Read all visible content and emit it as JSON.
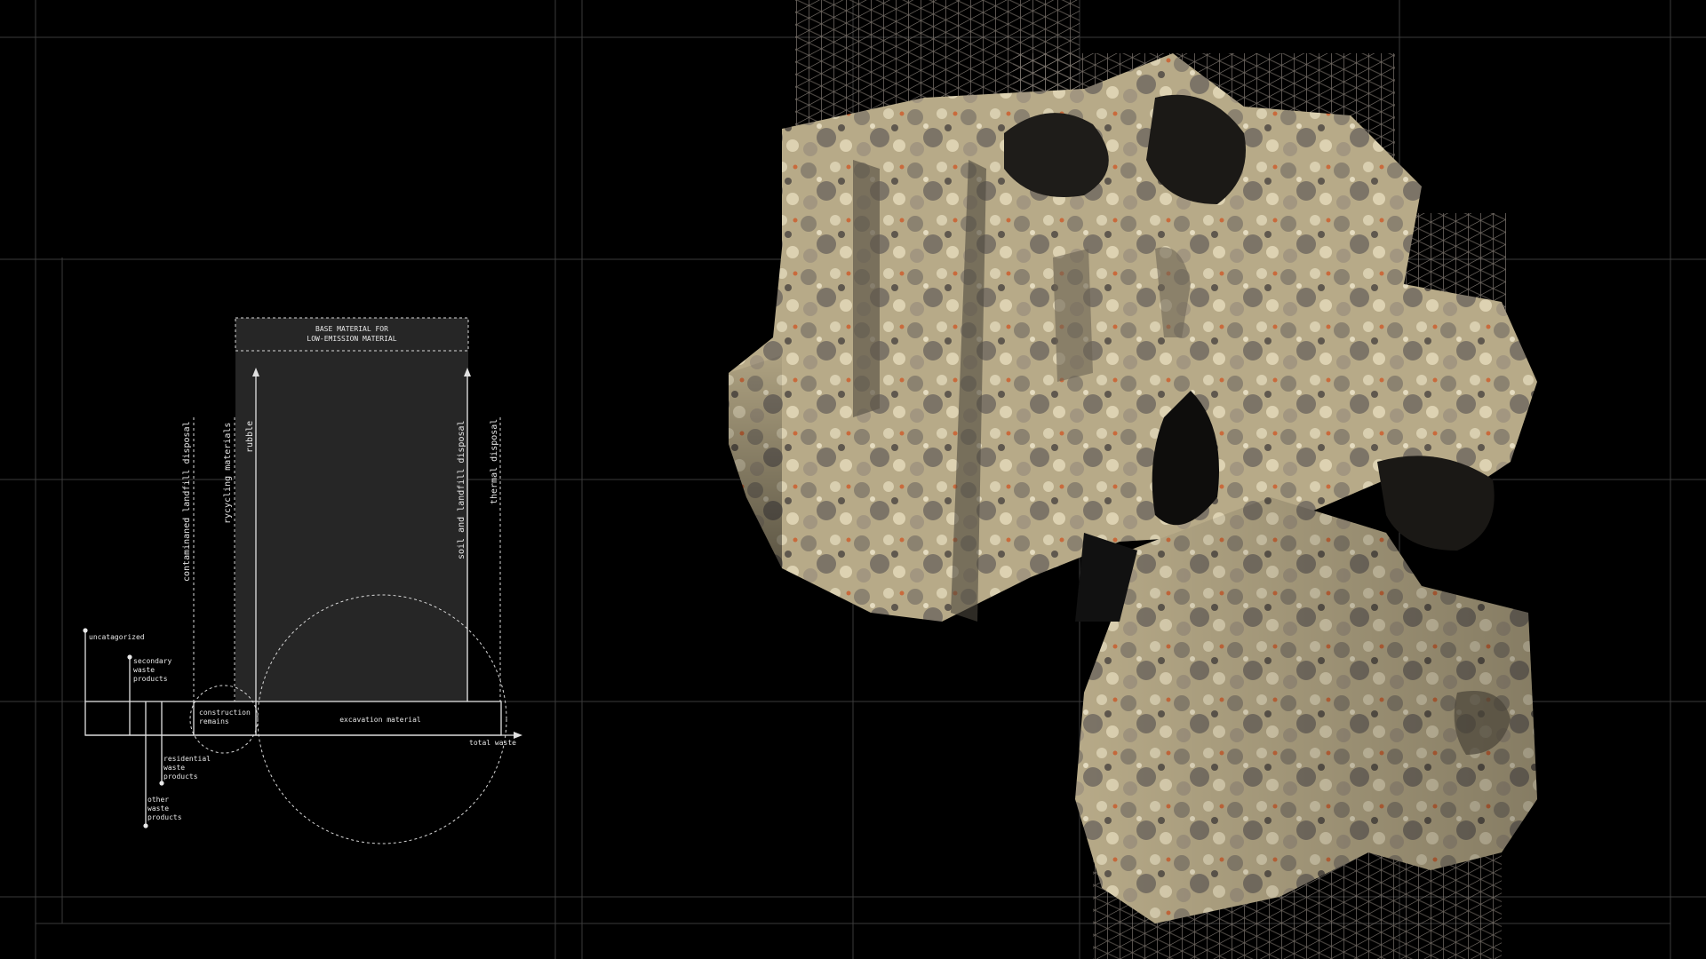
{
  "diagram": {
    "top_box_line1": "BASE MATERIAL FOR",
    "top_box_line2": "LOW-EMISSION MATERIAL",
    "vertical_labels": {
      "contaminated": "contaminaned landfill disposal",
      "recycling": "rycycling materials",
      "rubble": "rubble",
      "soil": "soil and landfill disposal",
      "thermal": "thermal disposal"
    },
    "uncategorized": "uncatagorized",
    "secondary": [
      "secondary",
      "waste",
      "products"
    ],
    "construction": [
      "construction",
      "remains"
    ],
    "excavation": "excavation material",
    "total_waste": "total waste",
    "residential": [
      "residential",
      "waste",
      "products"
    ],
    "other": [
      "other",
      "waste",
      "products"
    ]
  },
  "colors": {
    "background": "#000000",
    "panel": "#262626",
    "line": "#e0e0e0",
    "grid": "#3a3a3a",
    "stone_light": "#c9bc9a",
    "stone_dark": "#5e574a",
    "rebar": "#a89e93"
  }
}
